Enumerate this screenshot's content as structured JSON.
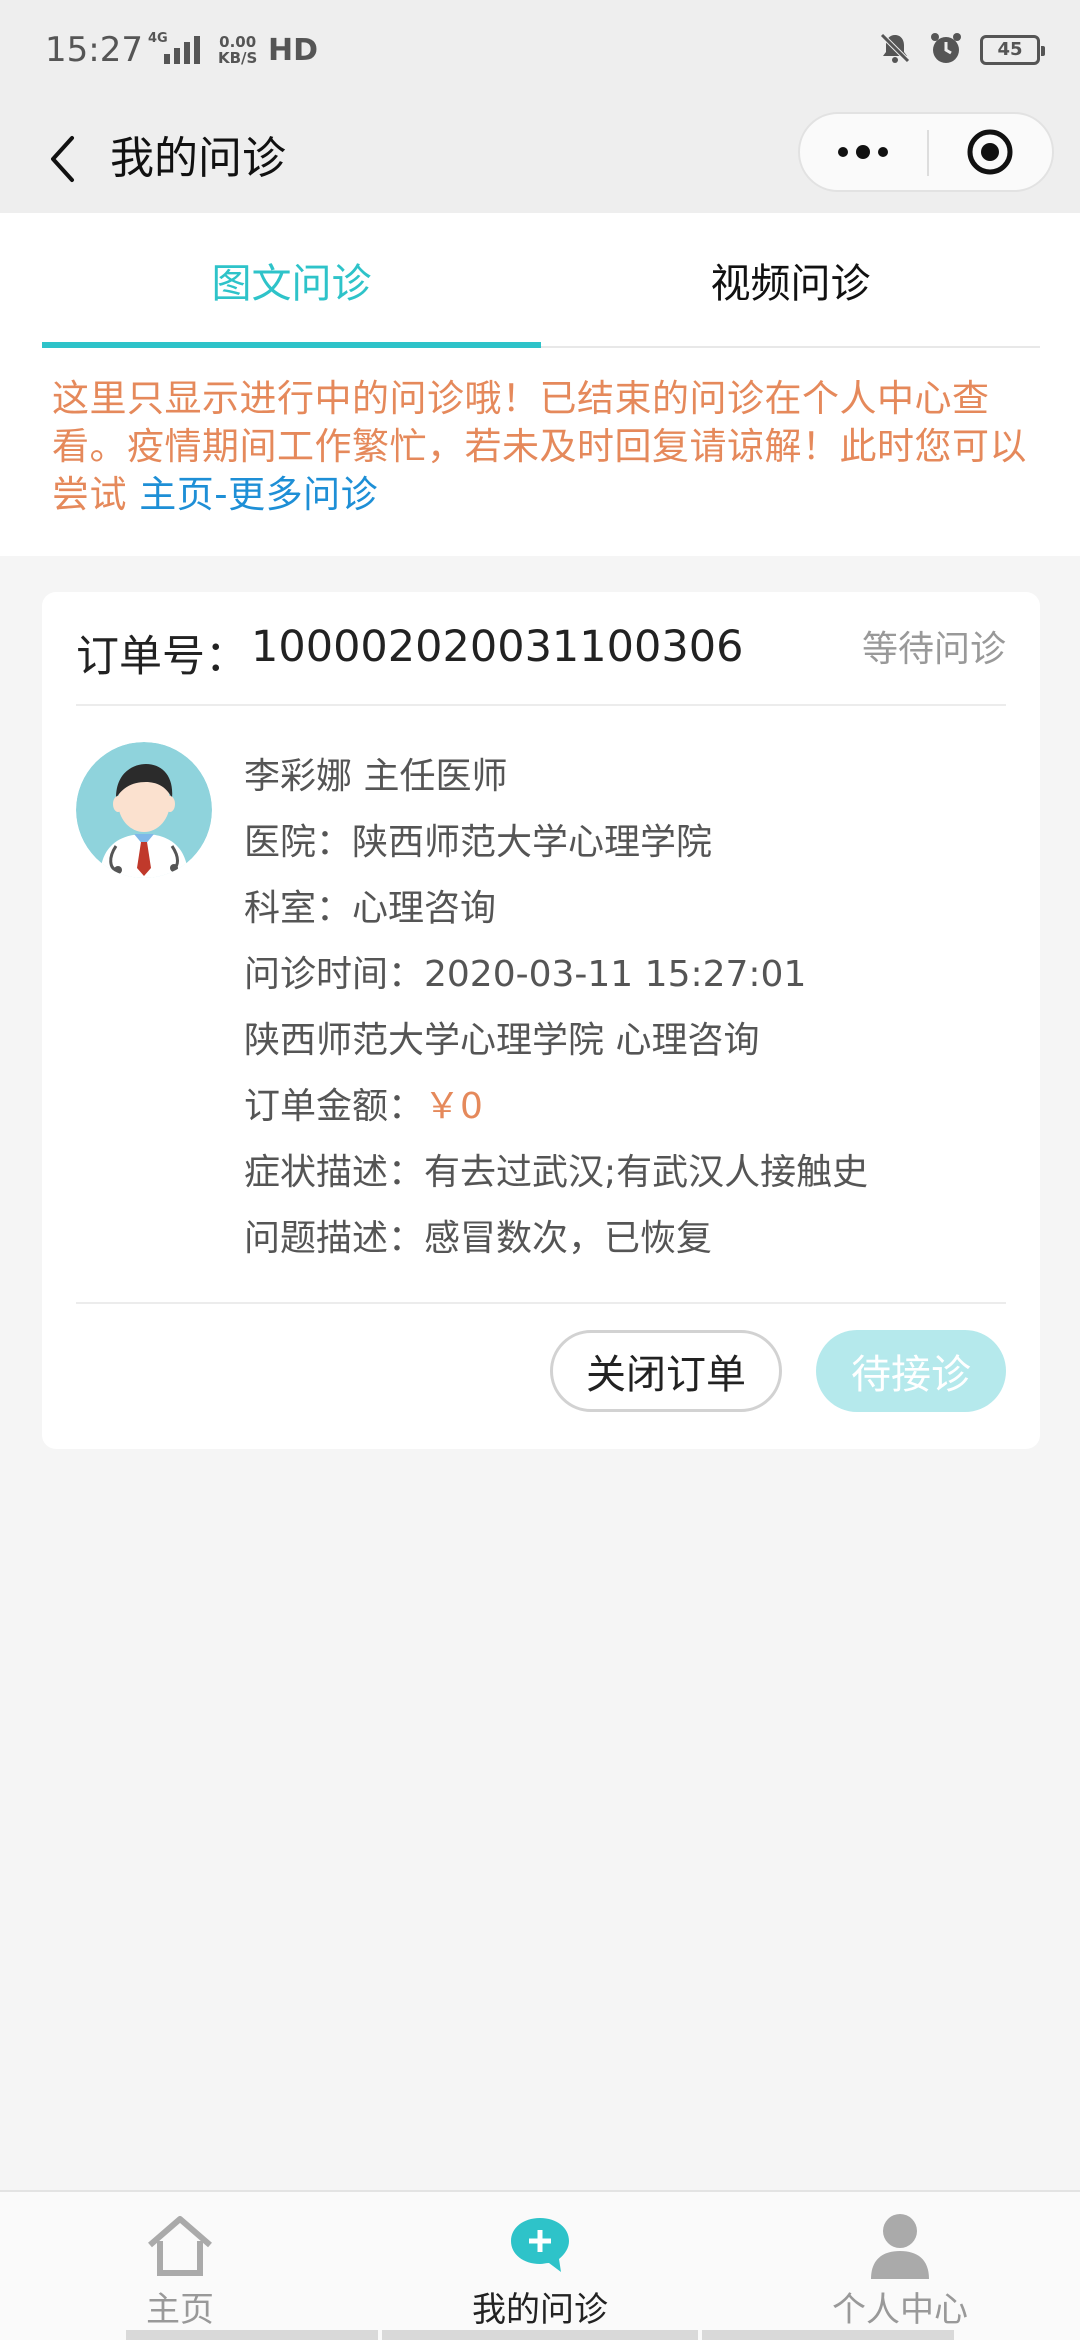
{
  "status_bar": {
    "time": "15:27",
    "network": "4G",
    "speed_top": "0.00",
    "speed_unit": "KB/S",
    "hd": "HD",
    "battery": "45"
  },
  "nav": {
    "title": "我的问诊"
  },
  "tabs": [
    {
      "label": "图文问诊",
      "active": true
    },
    {
      "label": "视频问诊",
      "active": false
    }
  ],
  "notice": {
    "text": "这里只显示进行中的问诊哦！已结束的问诊在个人中心查看。疫情期间工作繁忙，若未及时回复请谅解！此时您可以尝试 ",
    "link": "主页-更多问诊"
  },
  "order": {
    "label": "订单号：",
    "number": "100002020031100306",
    "status": "等待问诊",
    "doctor_line": "李彩娜   主任医师",
    "hospital": "医院：陕西师范大学心理学院",
    "department": "科室：心理咨询",
    "time": "问诊时间：2020-03-11 15:27:01",
    "hospital_dept": "陕西师范大学心理学院  心理咨询",
    "amount_label": "订单金额：",
    "amount_value": "￥0",
    "symptoms": "症状描述：有去过武汉;有武汉人接触史",
    "problem": "问题描述：感冒数次，已恢复",
    "close_button": "关闭订单",
    "wait_button": "待接诊"
  },
  "tabbar": [
    {
      "label": "主页",
      "icon": "home-icon",
      "active": false
    },
    {
      "label": "我的问诊",
      "icon": "chat-plus-icon",
      "active": true
    },
    {
      "label": "个人中心",
      "icon": "person-icon",
      "active": false
    }
  ],
  "colors": {
    "accent": "#2ec3c9",
    "notice": "#e5895b",
    "link": "#1e8fd6",
    "wait_button": "#b5e9ec"
  }
}
